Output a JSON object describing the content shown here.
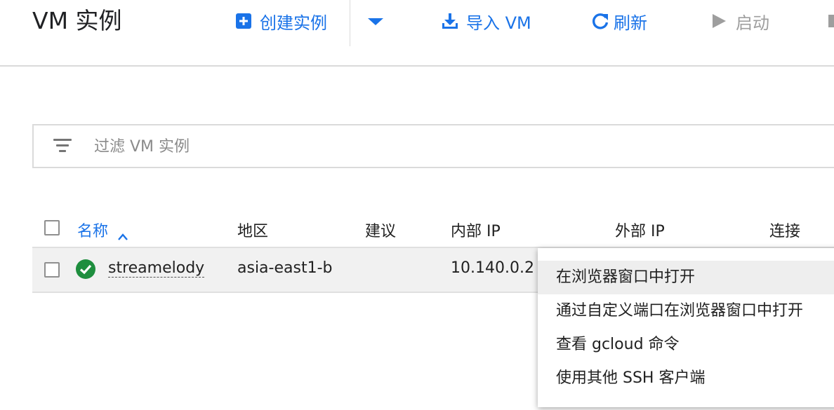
{
  "header": {
    "title": "VM 实例",
    "create_label": "创建实例",
    "import_label": "导入 VM",
    "refresh_label": "刷新",
    "start_label": "启动"
  },
  "filter": {
    "placeholder": "过滤 VM 实例"
  },
  "table": {
    "columns": [
      "名称",
      "地区",
      "建议",
      "内部 IP",
      "外部 IP",
      "连接"
    ],
    "rows": [
      {
        "name": "streamelody",
        "zone": "asia-east1-b",
        "recommendation": "",
        "internal_ip": "10.140.0.2",
        "status": "running"
      }
    ]
  },
  "menu": {
    "items": [
      "在浏览器窗口中打开",
      "通过自定义端口在浏览器窗口中打开",
      "查看 gcloud 命令",
      "使用其他 SSH 客户端"
    ]
  },
  "colors": {
    "accent": "#1a73e8",
    "status_ok": "#1e8e3e",
    "disabled": "#9e9e9e"
  },
  "icons": [
    "add-box-icon",
    "dropdown-arrow-icon",
    "download-icon",
    "refresh-icon",
    "play-icon",
    "stop-icon",
    "filter-icon",
    "sort-up-icon",
    "check-circle-icon"
  ]
}
